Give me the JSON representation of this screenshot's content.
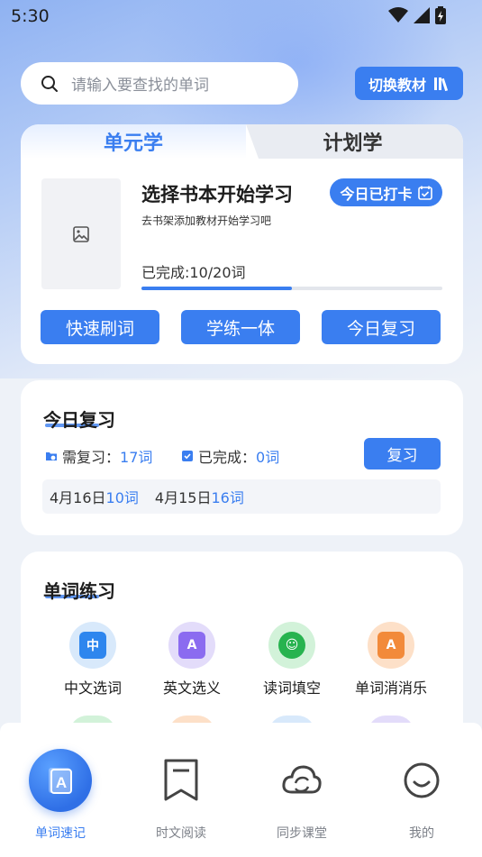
{
  "status_bar": {
    "time": "5:30"
  },
  "search": {
    "placeholder": "请输入要查找的单词"
  },
  "switch_button": {
    "label": "切换教材"
  },
  "study_card": {
    "tab_active": "单元学",
    "tab_inactive": "计划学",
    "title": "选择书本开始学习",
    "subtitle": "去书架添加教材开始学习吧",
    "checkin_label": "今日已打卡",
    "progress_text": "已完成:10/20词",
    "progress_completed": 10,
    "progress_total": 20,
    "actions": [
      "快速刷词",
      "学练一体",
      "今日复习"
    ]
  },
  "review_card": {
    "title": "今日复习",
    "need_label": "需复习：",
    "need_value": "17词",
    "done_label": "已完成：",
    "done_value": "0词",
    "review_button": "复习",
    "history": [
      {
        "date": "4月16日",
        "value": "10词"
      },
      {
        "date": "4月15日",
        "value": "16词"
      }
    ]
  },
  "practice_card": {
    "title": "单词练习",
    "items": [
      {
        "label": "中文选词",
        "icon": "chinese-choice-icon",
        "bg": "#d8e9fb",
        "color": "#2e86ee"
      },
      {
        "label": "英文选义",
        "icon": "english-meaning-icon",
        "bg": "#e3dcfa",
        "color": "#8b6bf0"
      },
      {
        "label": "读词填空",
        "icon": "read-fill-icon",
        "bg": "#d2f2d9",
        "color": "#27b34f"
      },
      {
        "label": "单词消消乐",
        "icon": "word-match-icon",
        "bg": "#fde0c8",
        "color": "#f28a3a"
      }
    ]
  },
  "bottom_nav": {
    "items": [
      {
        "label": "单词速记",
        "icon": "flashcard-a-icon",
        "active": true
      },
      {
        "label": "时文阅读",
        "icon": "bookmark-icon",
        "active": false
      },
      {
        "label": "同步课堂",
        "icon": "cloud-sync-icon",
        "active": false
      },
      {
        "label": "我的",
        "icon": "smiley-icon",
        "active": false
      }
    ]
  }
}
